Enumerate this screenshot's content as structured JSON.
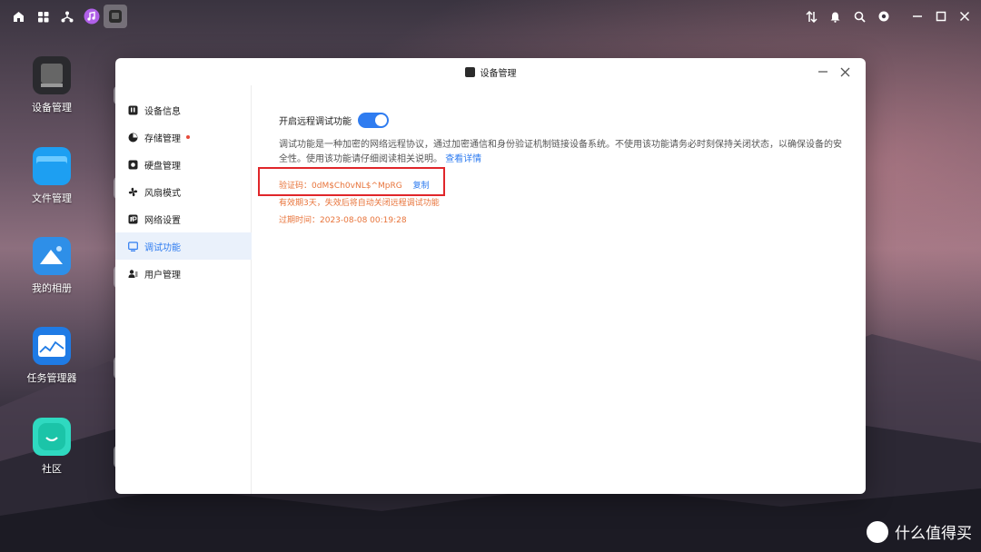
{
  "desktop": {
    "items": [
      {
        "label": "设备管理",
        "icon": "device-manager-icon"
      },
      {
        "label": "文件管理",
        "icon": "folder-icon"
      },
      {
        "label": "我的相册",
        "icon": "photo-album-icon"
      },
      {
        "label": "任务管理器",
        "icon": "task-manager-icon"
      },
      {
        "label": "社区",
        "icon": "community-icon"
      }
    ]
  },
  "window": {
    "title": "设备管理",
    "sidebar": {
      "items": [
        {
          "label": "设备信息",
          "icon": "device-info-icon"
        },
        {
          "label": "存储管理",
          "icon": "storage-icon"
        },
        {
          "label": "硬盘管理",
          "icon": "disk-icon"
        },
        {
          "label": "风扇模式",
          "icon": "fan-icon"
        },
        {
          "label": "网络设置",
          "icon": "network-icon"
        },
        {
          "label": "调试功能",
          "icon": "debug-icon"
        },
        {
          "label": "用户管理",
          "icon": "users-icon"
        }
      ]
    },
    "debug": {
      "toggle_label": "开启远程调试功能",
      "toggle_on": true,
      "description": "调试功能是一种加密的网络远程协议，通过加密通信和身份验证机制链接设备系统。不使用该功能请务必时刻保持关闭状态，以确保设备的安全性。使用该功能请仔细阅读相关说明。",
      "detail_link": "查看详情",
      "code_text": "验证码：0dM$Ch0vNL$^MpRG",
      "copy_label": "复制",
      "validity_text": "有效期3天，失效后将自动关闭远程调试功能",
      "expire_text": "过期时间：2023-08-08 00:19:28"
    }
  },
  "watermark": {
    "text": "什么值得买",
    "logo": "值"
  },
  "colors": {
    "accent": "#2f7cf0",
    "warning": "#e8743b",
    "highlight": "#e0262a"
  }
}
